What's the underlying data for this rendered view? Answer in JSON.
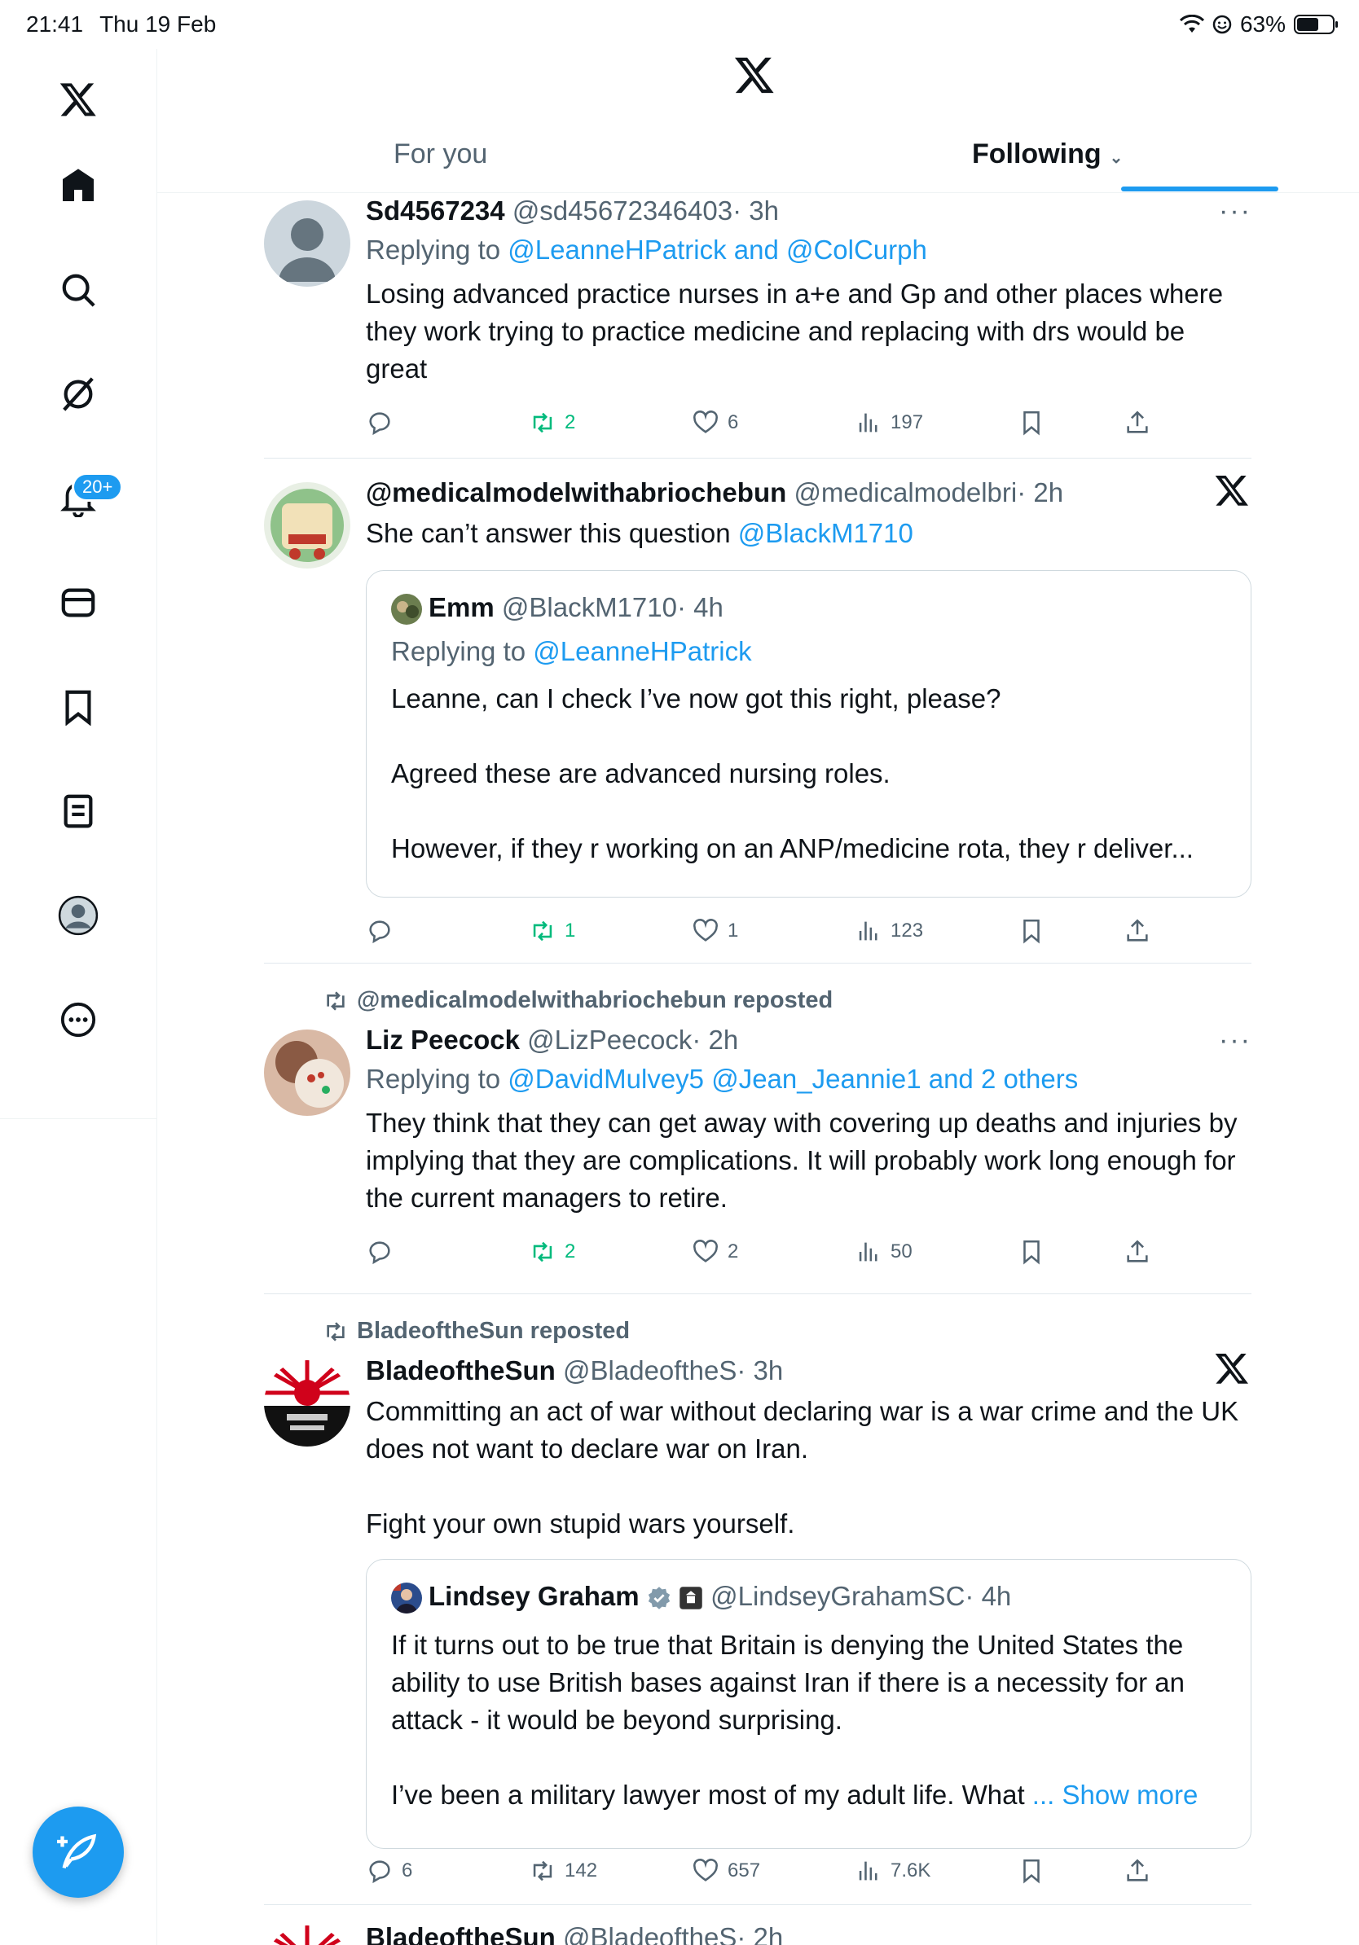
{
  "status_bar": {
    "time": "21:41",
    "date": "Thu 19 Feb",
    "battery": "63%",
    "battery_level": 0.63
  },
  "sidebar": {
    "notifications_badge": "20+",
    "icons": [
      "x-logo-icon",
      "home-icon",
      "search-icon",
      "grok-icon",
      "notifications-icon",
      "messages-icon",
      "bookmarks-icon",
      "lists-icon",
      "profile-icon",
      "more-icon"
    ]
  },
  "tabs": {
    "for_you": "For you",
    "following": "Following",
    "following_chevron": "⌄"
  },
  "tweets": [
    {
      "name": "Sd4567234",
      "handle": "@sd45672346403",
      "time": "· 3h",
      "replying_prefix": "Replying to",
      "replying_to": "@LeanneHPatrick and @ColCurph",
      "text": "Losing advanced practice nurses in a+e and Gp and other places where they work  trying to practice medicine and replacing with drs would be great",
      "more": "···",
      "replies": "",
      "reposts": "2",
      "likes": "6",
      "views": "197"
    },
    {
      "name": "@medicalmodelwithabriochebun",
      "handle": "@medicalmodelbri",
      "time": "· 2h",
      "text_prefix": "She can’t answer this question ",
      "text_link": "@BlackM1710",
      "quote": {
        "name": "Emm",
        "handle": "@BlackM1710",
        "time": "· 4h",
        "replying_prefix": "Replying to",
        "replying_to": "@LeanneHPatrick",
        "text": "Leanne, can I check I’ve now got this right, please?\n\nAgreed these are advanced nursing roles.\n\nHowever, if they r working on an ANP/medicine rota, they r deliver..."
      },
      "replies": "",
      "reposts": "1",
      "likes": "1",
      "views": "123"
    },
    {
      "repost_label": "@medicalmodelwithabriochebun reposted",
      "name": "Liz Peecock",
      "handle": "@LizPeecock",
      "time": "· 2h",
      "replying_prefix": "Replying to",
      "replying_to": "@DavidMulvey5 @Jean_Jeannie1 and 2 others",
      "text": "They think that they can get away with covering up deaths and injuries by implying that they are complications.  It will probably work long enough for the current managers to retire.",
      "more": "···",
      "replies": "",
      "reposts": "2",
      "likes": "2",
      "views": "50"
    },
    {
      "repost_label": "BladeoftheSun reposted",
      "name": "BladeoftheSun",
      "handle": "@BladeoftheS",
      "time": "· 3h",
      "text": "Committing an act of war without declaring war is a war crime and the UK does not want to declare war on Iran.\n\nFight your own stupid wars yourself.",
      "quote": {
        "name": "Lindsey Graham",
        "handle": "@LindseyGrahamSC",
        "time": "· 4h",
        "text": "If it turns out to be true that Britain is denying the United States the ability to use British bases against Iran if there is a necessity for an attack - it would be beyond surprising.\n\nI’ve been a military lawyer most of my adult life. What ",
        "show_more": "... Show more"
      },
      "replies": "6",
      "reposts": "142",
      "likes": "657",
      "views": "7.6K"
    },
    {
      "name": "BladeoftheSun",
      "handle": "@BladeoftheS",
      "time": "· 2h"
    }
  ],
  "colors": {
    "accent": "#1d9bf0",
    "repost_green": "#00ba7c",
    "secondary_text": "#536471"
  }
}
